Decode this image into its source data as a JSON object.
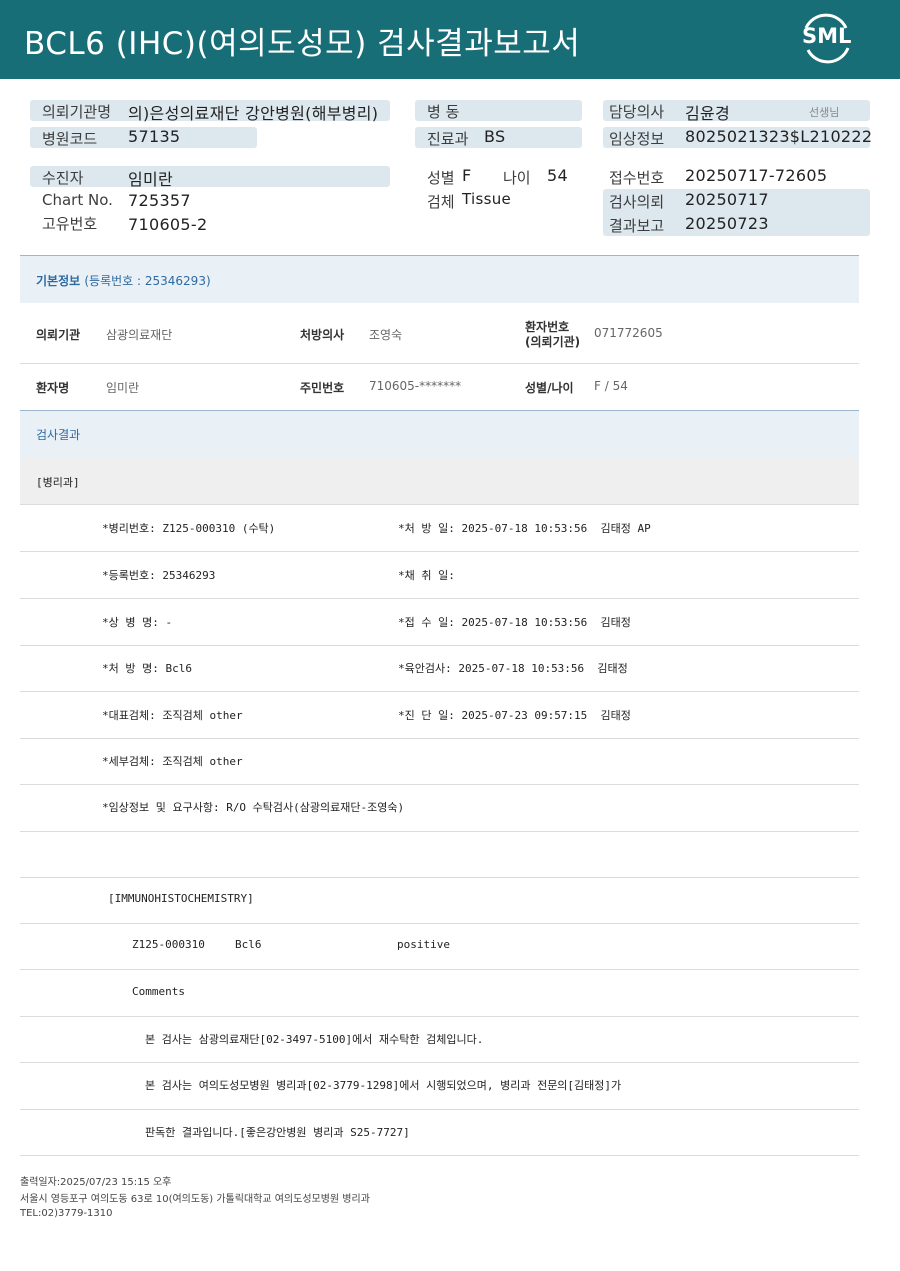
{
  "header": {
    "title": "BCL6 (IHC)(여의도성모) 검사결과보고서",
    "logo_text": "SML",
    "bg_color": "#176e77"
  },
  "top": {
    "ref_hospital_label": "의뢰기관명",
    "ref_hospital_value": "의)은성의료재단 강안병원(해부병리)",
    "hospital_code_label": "병원코드",
    "hospital_code_value": "57135",
    "ward_label": "병  동",
    "dept_label": "진료과",
    "dept_value": "BS",
    "doctor_label": "담당의사",
    "doctor_value": "김윤경",
    "doctor_suffix": "선생님",
    "clinical_label": "임상정보",
    "clinical_value": "8025021323$L210222",
    "patient_label": "수진자",
    "patient_value": "임미란",
    "chart_label": "Chart No.",
    "chart_value": "725357",
    "uid_label": "고유번호",
    "uid_value": "710605-2",
    "sex_label": "성별",
    "sex_value": "F",
    "age_label": "나이",
    "age_value": "54",
    "specimen_label": "검체",
    "specimen_value": "Tissue",
    "receipt_label": "접수번호",
    "receipt_value": "20250717-72605",
    "request_label": "검사의뢰",
    "request_value": "20250717",
    "report_label": "결과보고",
    "report_value": "20250723"
  },
  "basic": {
    "title": "기본정보",
    "reg": "(등록번호 : 25346293)",
    "rows": [
      {
        "k1": "의뢰기관",
        "v1": "삼광의료재단",
        "k2": "처방의사",
        "v2": "조영숙",
        "k3a": "환자번호",
        "k3b": "(의뢰기관)",
        "v3": "071772605"
      },
      {
        "k1": "환자명",
        "v1": "임미란",
        "k2": "주민번호",
        "v2": "710605-*******",
        "k3": "성별/나이",
        "v3": "F / 54"
      }
    ]
  },
  "result": {
    "title": "검사결과",
    "dept": "[병리과]",
    "rows": [
      {
        "left": "*병리번호: Z125-000310 (수탁)",
        "right": "*처 방 일: 2025-07-18 10:53:56  김태정 AP"
      },
      {
        "left": "*등록번호: 25346293",
        "right": "*채 취 일:"
      },
      {
        "left": "*상 병 명: -",
        "right": "*접 수 일: 2025-07-18 10:53:56  김태정"
      },
      {
        "left": "*처 방 명: Bcl6",
        "right": "*육안검사: 2025-07-18 10:53:56  김태정"
      },
      {
        "left": "*대표검체: 조직검체 other",
        "right": "*진 단 일: 2025-07-23 09:57:15  김태정"
      },
      {
        "left": "*세부검체: 조직검체 other",
        "right": ""
      },
      {
        "left": "*임상정보 및 요구사항: R/O 수탁검사(삼광의료재단-조영숙)",
        "right": ""
      }
    ],
    "ihc_title": "[IMMUNOHISTOCHEMISTRY]",
    "ihc_id": "Z125-000310",
    "ihc_marker": "Bcl6",
    "ihc_result": "positive",
    "comments_label": "Comments",
    "comment1": "본 검사는 삼광의료재단[02-3497-5100]에서 재수탁한 검체입니다.",
    "comment2": "본 검사는 여의도성모병원 병리과[02-3779-1298]에서 시행되었으며, 병리과 전문의[김태정]가",
    "comment3": "판독한 결과입니다.[좋은강안병원 병리과 S25-7727]"
  },
  "footer": {
    "printed": "출력일자:2025/07/23 15:15 오후",
    "address": "서울시 영등포구 여의도동 63로 10(여의도동) 가톨릭대학교 여의도성모병원 병리과",
    "tel": "TEL:02)3779-1310"
  }
}
